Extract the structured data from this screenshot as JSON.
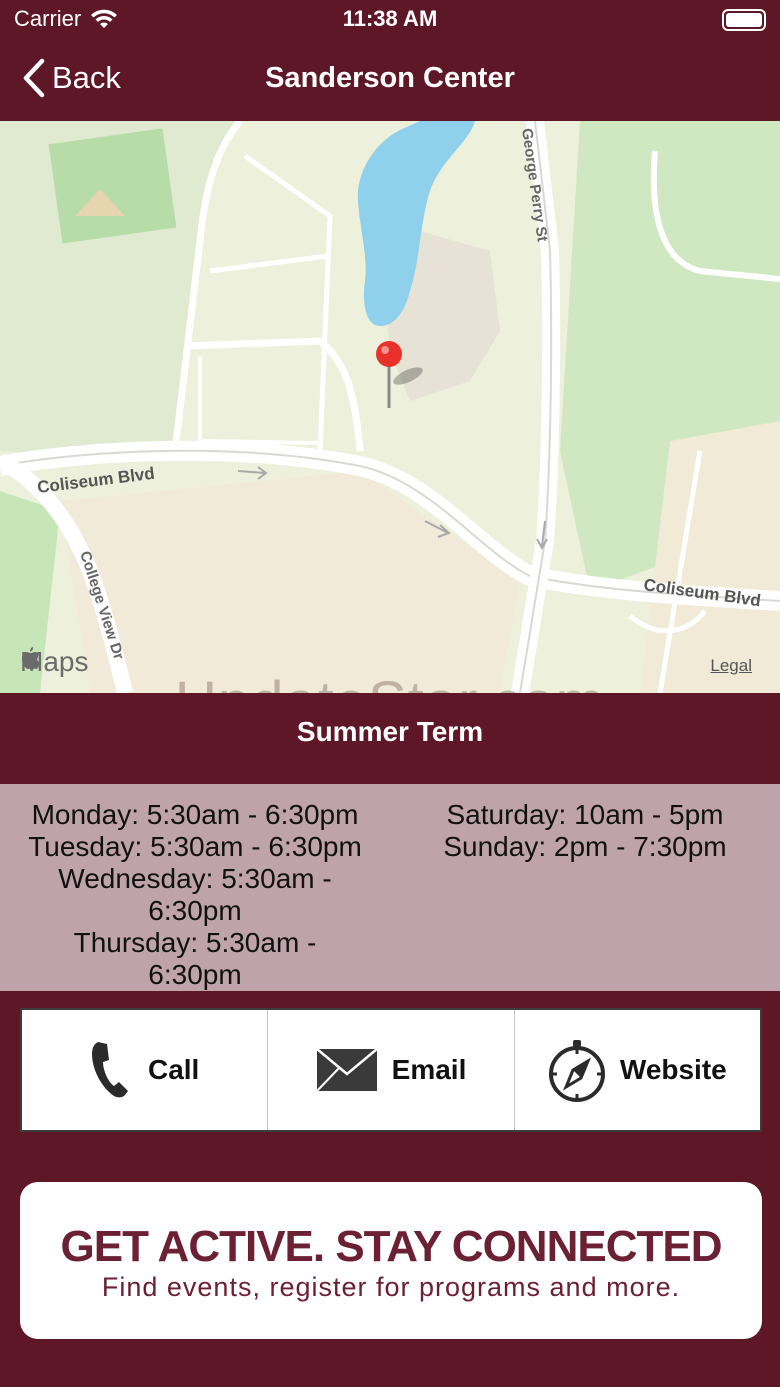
{
  "status_bar": {
    "carrier": "Carrier",
    "time": "11:38 AM"
  },
  "nav": {
    "back_label": "Back",
    "title": "Sanderson Center"
  },
  "map": {
    "road_labels": {
      "coliseum_blvd_west": "Coliseum Blvd",
      "coliseum_blvd_east": "Coliseum Blvd",
      "george_perry_st": "George Perry St",
      "college_view_dr": "College View Dr"
    },
    "maps_logo": "Maps",
    "legal": "Legal",
    "watermark": "UpdateStar.com"
  },
  "term": {
    "title": "Summer Term"
  },
  "hours": {
    "left": [
      "Monday: 5:30am - 6:30pm",
      "Tuesday: 5:30am - 6:30pm",
      "Wednesday: 5:30am -",
      "6:30pm",
      "Thursday: 5:30am -",
      "6:30pm"
    ],
    "right": [
      "Saturday: 10am - 5pm",
      "Sunday: 2pm - 7:30pm"
    ]
  },
  "actions": {
    "call": "Call",
    "email": "Email",
    "website": "Website"
  },
  "banner": {
    "headline": "GET ACTIVE.  STAY CONNECTED",
    "subtitle": "Find events, register for programs and more."
  },
  "colors": {
    "brand": "#5e1727",
    "hours_bg": "#bea3aa",
    "water": "#8fd0ec",
    "pin": "#e8312b"
  }
}
